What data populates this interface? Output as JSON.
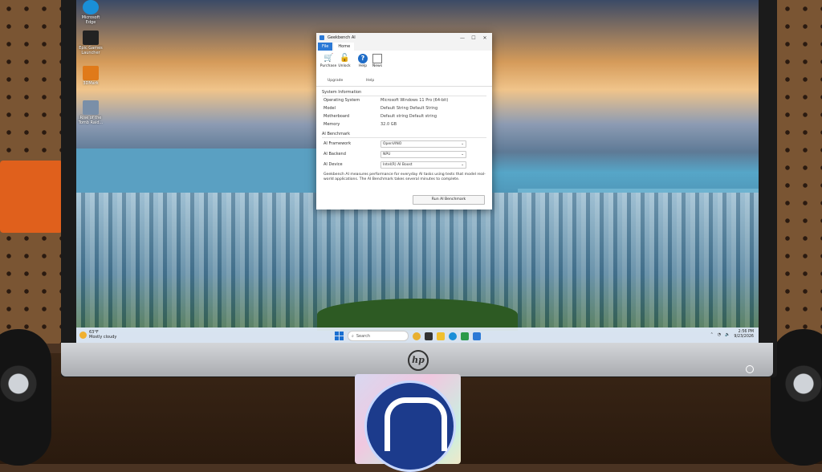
{
  "desktop_icons": [
    {
      "label": "Microsoft Edge",
      "icon": "edge-icon",
      "color": "#1a8fd8"
    },
    {
      "label": "Epic Games Launcher",
      "icon": "epic-games-icon",
      "color": "#222222"
    },
    {
      "label": "3DMark",
      "icon": "3dmark-icon",
      "color": "#e07a1a"
    },
    {
      "label": "Rise of the Tomb Raid...",
      "icon": "tomb-raider-icon",
      "color": "#7a8fa8"
    }
  ],
  "window": {
    "title": "Geekbench AI",
    "controls": {
      "minimize": "—",
      "maximize": "☐",
      "close": "✕"
    },
    "tabs": {
      "file": "File",
      "home": "Home"
    },
    "ribbon": {
      "purchase": "Purchase",
      "unlock": "Unlock",
      "help": "Help",
      "news": "News",
      "group_upgrade": "Upgrade",
      "group_help": "Help"
    },
    "system_info": {
      "title": "System Information",
      "rows": [
        {
          "key": "Operating System",
          "value": "Microsoft Windows 11 Pro (64-bit)"
        },
        {
          "key": "Model",
          "value": "Default String Default String"
        },
        {
          "key": "Motherboard",
          "value": "Default string Default string"
        },
        {
          "key": "Memory",
          "value": "32.0 GB"
        }
      ]
    },
    "ai_benchmark": {
      "title": "AI Benchmark",
      "framework_label": "AI Framework",
      "framework_value": "OpenVINO",
      "backend_label": "AI Backend",
      "backend_value": "NPU",
      "device_label": "AI Device",
      "device_value": "Intel(R) AI Boost",
      "description": "Geekbench AI measures performance for everyday AI tasks using tests that model real-world applications. The AI Benchmark takes several minutes to complete.",
      "run_button": "Run AI Benchmark"
    }
  },
  "taskbar": {
    "weather_temp": "63°F",
    "weather_text": "Mostly cloudy",
    "search_placeholder": "Search",
    "time": "2:56 PM",
    "date": "9/23/2026"
  },
  "monitor": {
    "brand": "hp"
  }
}
